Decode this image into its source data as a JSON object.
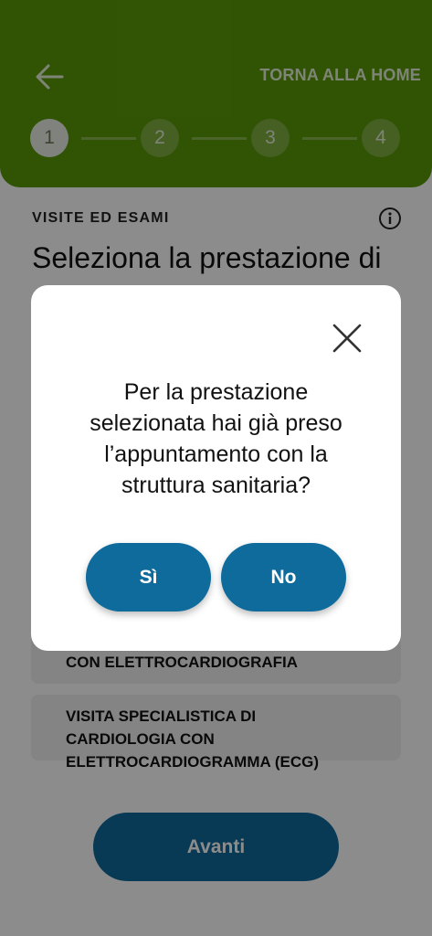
{
  "header": {
    "back_icon": "arrow-left-icon",
    "home_link": "TORNA ALLA HOME",
    "steps": [
      "1",
      "2",
      "3",
      "4"
    ],
    "active_step": 1,
    "background_color": "#5a9a08"
  },
  "main": {
    "section_label": "VISITE ED ESAMI",
    "info_icon": "info-icon",
    "title": "Seleziona la prestazione di",
    "options": [
      {
        "label": "CON ELETTROCARDIOGRAFIA"
      },
      {
        "label": "VISITA SPECIALISTICA DI CARDIOLOGIA CON ELETTROCARDIOGRAMMA (ECG)"
      }
    ],
    "next_button": "Avanti"
  },
  "modal": {
    "close_icon": "close-icon",
    "question": "Per la prestazione selezionata hai già preso l’appuntamento con la struttura sanitaria?",
    "yes_button": "Sì",
    "no_button": "No",
    "button_color": "#0f6b9c"
  }
}
